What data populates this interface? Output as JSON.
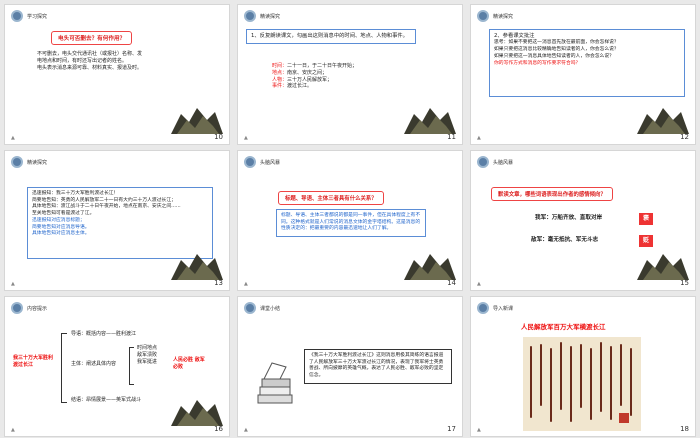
{
  "slides": [
    {
      "number": "10",
      "header": "学习探究",
      "question": "电头可否删去？有何作用？",
      "lines": [
        "不可删去，电头交代通讯社（或报社）名称、发",
        "电地点和时间，有时还写出记者的姓名。",
        "电头表示消息来源可靠、材料真实、报道及时。"
      ]
    },
    {
      "number": "11",
      "header": "精读探究",
      "task": "1、反复朗读课文，勾画出这则消息中的时间、地点、人物和事件。",
      "rows": [
        {
          "k": "时间：",
          "v": "二十一日，于二十日午夜开始；"
        },
        {
          "k": "地点：",
          "v": "南京、安庆之间；"
        },
        {
          "k": "人物：",
          "v": "三十万人民解放军；"
        },
        {
          "k": "事件：",
          "v": "渡过长江。"
        }
      ]
    },
    {
      "number": "12",
      "header": "精读探究",
      "task": "2、参看课文批注",
      "lines": [
        "思考：如果不要把这一消息首先放在最前面，你会怎样说？",
        "如果只要把这消息比较精确地告知读者的人，你会怎么说？",
        "如果只要把这一消息具体地告知读者的人，你会怎么说？",
        "你的写作方式和消息的写作要求符合吗？"
      ]
    },
    {
      "number": "13",
      "header": "精读探究",
      "lines": [
        "迅速报知：我三十万大军胜利渡过长江！",
        "简要地告知：英勇的人民解放军二十一日有大约三十万人渡过长江；",
        "具体地告知：渡江战斗于二十日午夜开始，地点在南京、安庆之间……",
        "至关地告知可看是渡过了江。"
      ],
      "summary": [
        "迅速报知对应消息标题；",
        "简要地告知对应消息导语。",
        "具体地告知对应消息主体。"
      ]
    },
    {
      "number": "14",
      "header": "头脑风暴",
      "question": "标题、导语、主体三者具有什么关系？",
      "answer": "标题、导语、主体三者都说的都是同一事件，但在具体程度上有不同。这种格式就是人们常说的消息文体的金字塔结构。这是消息的性质决定的：把最重要的内容最迅速地让人们了解。"
    },
    {
      "number": "15",
      "header": "头脑风暴",
      "question": "默读文章，哪些词语表现出作者的感情倾向？",
      "our": "我军：万船齐放、直取对岸",
      "enemy": "敌军：毫无抵抗、军无斗志",
      "badge1": "褒",
      "badge2": "贬"
    },
    {
      "number": "16",
      "header": "内容提示",
      "left": "我三十万大军胜利渡过长江",
      "right": "人民必胜 敌军必败",
      "items": [
        "导语：概括内容——胜利渡江",
        "主体：阐述具体内容",
        "结语：昂情展景——英军式战斗"
      ],
      "sub": [
        "时间地点",
        "敌军溃败",
        "我军挺进"
      ]
    },
    {
      "number": "17",
      "header": "课堂小结",
      "text": "《我三十万大军胜利渡过长江》这则消息用极其简练的语言报道了人民解放军三十万大军渡过长江的情况，表现了我军将士英勇善战、所向披靡的英雄气概，表达了人民必胜、敌军必败的坚定信念。"
    },
    {
      "number": "18",
      "header": "导入新课",
      "title": "人民解放军百万大军横渡长江"
    }
  ]
}
